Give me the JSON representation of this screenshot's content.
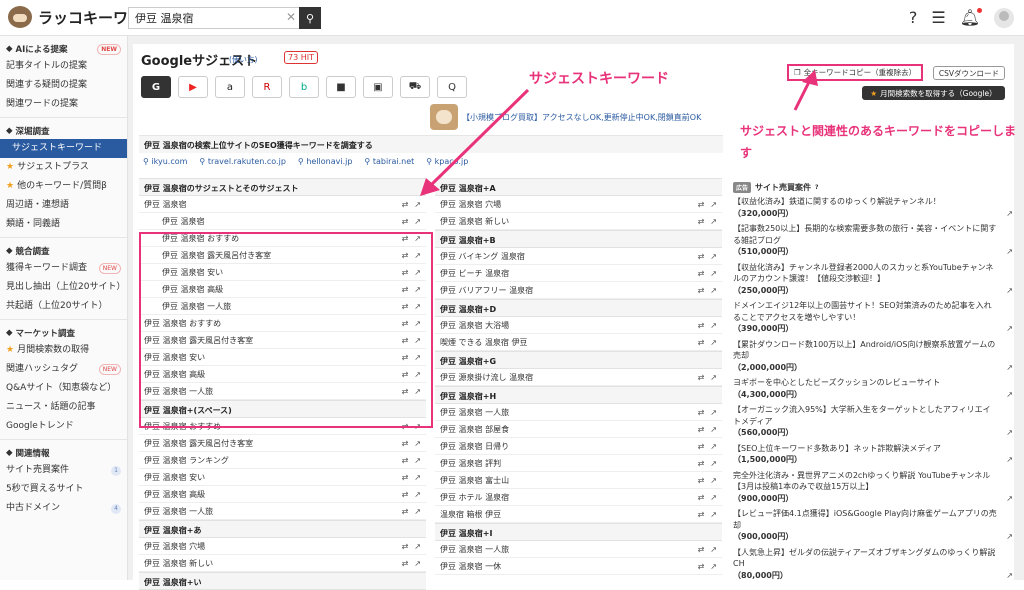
{
  "app": {
    "logo_text": "ラッコキーワード"
  },
  "search": {
    "value": "伊豆 温泉宿"
  },
  "sidebar": {
    "sections": [
      {
        "title": "AIによる提案",
        "badge": "NEW",
        "items": [
          {
            "label": "記事タイトルの提案"
          },
          {
            "label": "関連する疑問の提案"
          },
          {
            "label": "関連ワードの提案"
          }
        ]
      },
      {
        "title": "深堀調査",
        "items": [
          {
            "label": "サジェストキーワード",
            "active": true
          },
          {
            "label": "サジェストプラス",
            "star": true
          },
          {
            "label": "他のキーワード/質問β",
            "star": true
          },
          {
            "label": "周辺語・連想語"
          },
          {
            "label": "類語・同義語"
          }
        ]
      },
      {
        "title": "競合調査",
        "items": [
          {
            "label": "獲得キーワード調査",
            "badge": "NEW"
          },
          {
            "label": "見出し抽出（上位20サイト）"
          },
          {
            "label": "共起語（上位20サイト）"
          }
        ]
      },
      {
        "title": "マーケット調査",
        "items": [
          {
            "label": "月間検索数の取得",
            "star": true
          },
          {
            "label": "関連ハッシュタグ",
            "badge": "NEW"
          },
          {
            "label": "Q&Aサイト（知恵袋など）"
          },
          {
            "label": "ニュース・話題の記事"
          },
          {
            "label": "Googleトレンド"
          }
        ]
      },
      {
        "title": "関連情報",
        "items": [
          {
            "label": "サイト売買案件",
            "count": "1"
          },
          {
            "label": "5秒で買えるサイト"
          },
          {
            "label": "中古ドメイン",
            "count": "4"
          }
        ]
      }
    ]
  },
  "header": {
    "title": "Googleサジェスト",
    "howto": "使い方",
    "hits": "73 HIT",
    "copy_all": "全キーワードコピー（重複除去）",
    "csv": "CSVダウンロード",
    "monthly": "月間検索数を取得する（Google）"
  },
  "engines": [
    {
      "name": "google",
      "label": "G"
    },
    {
      "name": "youtube",
      "label": "▶"
    },
    {
      "name": "amazon",
      "label": "a"
    },
    {
      "name": "rakuten",
      "label": "R"
    },
    {
      "name": "bing",
      "label": "b"
    },
    {
      "name": "video",
      "label": "■"
    },
    {
      "name": "image",
      "label": "▣"
    },
    {
      "name": "shopping",
      "label": "⛟"
    },
    {
      "name": "qa",
      "label": "Q"
    }
  ],
  "banner": {
    "text": "【小規模ブログ買取】アクセスなしOK,更新停止中OK,閉鎖直前OK"
  },
  "seo": {
    "heading": "伊豆 温泉宿の検索上位サイトのSEO獲得キーワードを調査する",
    "sites": [
      "ikyu.com",
      "travel.rakuten.co.jp",
      "hellonavi.jp",
      "tabirai.net",
      "kpaco.jp"
    ]
  },
  "col1": [
    {
      "heading": "伊豆 温泉宿のサジェストとそのサジェスト",
      "rows": [
        {
          "text": "伊豆 温泉宿"
        },
        {
          "text": "伊豆 温泉宿",
          "sub": true
        },
        {
          "text": "伊豆 温泉宿 おすすめ",
          "sub": true
        },
        {
          "text": "伊豆 温泉宿 露天風呂付き客室",
          "sub": true
        },
        {
          "text": "伊豆 温泉宿 安い",
          "sub": true
        },
        {
          "text": "伊豆 温泉宿 高級",
          "sub": true
        },
        {
          "text": "伊豆 温泉宿 一人旅",
          "sub": true
        },
        {
          "text": "伊豆 温泉宿 おすすめ"
        },
        {
          "text": "伊豆 温泉宿 露天風呂付き客室"
        },
        {
          "text": "伊豆 温泉宿 安い"
        },
        {
          "text": "伊豆 温泉宿 高級"
        },
        {
          "text": "伊豆 温泉宿 一人旅"
        }
      ]
    },
    {
      "heading": "伊豆 温泉宿+(スペース)",
      "rows": [
        {
          "text": "伊豆 温泉宿 おすすめ"
        },
        {
          "text": "伊豆 温泉宿 露天風呂付き客室"
        },
        {
          "text": "伊豆 温泉宿 ランキング"
        },
        {
          "text": "伊豆 温泉宿 安い"
        },
        {
          "text": "伊豆 温泉宿 高級"
        },
        {
          "text": "伊豆 温泉宿 一人旅"
        }
      ]
    },
    {
      "heading": "伊豆 温泉宿+あ",
      "rows": [
        {
          "text": "伊豆 温泉宿 穴場"
        },
        {
          "text": "伊豆 温泉宿 新しい"
        }
      ]
    },
    {
      "heading": "伊豆 温泉宿+い",
      "rows": []
    }
  ],
  "col2": [
    {
      "heading": "伊豆 温泉宿+A",
      "rows": [
        {
          "text": "伊豆 温泉宿 穴場"
        },
        {
          "text": "伊豆 温泉宿 新しい"
        }
      ]
    },
    {
      "heading": "伊豆 温泉宿+B",
      "rows": [
        {
          "text": "伊豆 バイキング 温泉宿"
        },
        {
          "text": "伊豆 ビーチ 温泉宿"
        },
        {
          "text": "伊豆 バリアフリー 温泉宿"
        }
      ]
    },
    {
      "heading": "伊豆 温泉宿+D",
      "rows": [
        {
          "text": "伊豆 温泉宿 大浴場"
        },
        {
          "text": "喫煙 できる 温泉宿 伊豆"
        }
      ]
    },
    {
      "heading": "伊豆 温泉宿+G",
      "rows": [
        {
          "text": "伊豆 源泉掛け流し 温泉宿"
        }
      ]
    },
    {
      "heading": "伊豆 温泉宿+H",
      "rows": [
        {
          "text": "伊豆 温泉宿 一人旅"
        },
        {
          "text": "伊豆 温泉宿 部屋食"
        },
        {
          "text": "伊豆 温泉宿 日帰り"
        },
        {
          "text": "伊豆 温泉宿 評判"
        },
        {
          "text": "伊豆 温泉宿 富士山"
        },
        {
          "text": "伊豆 ホテル 温泉宿"
        },
        {
          "text": "温泉宿 箱根 伊豆"
        }
      ]
    },
    {
      "heading": "伊豆 温泉宿+I",
      "rows": [
        {
          "text": "伊豆 温泉宿 一人旅"
        },
        {
          "text": "伊豆 温泉宿 一休"
        }
      ]
    }
  ],
  "ads": {
    "tag": "広告",
    "heading": "サイト売買案件",
    "items": [
      {
        "text": "【収益化済み】鉄道に関するのゆっくり解説チャンネル！",
        "price": "（320,000円）"
      },
      {
        "text": "【記事数250以上】長期的な検索需要多数の旅行・美容・イベントに関する雑記ブログ",
        "price": "（510,000円）"
      },
      {
        "text": "【収益化済み】チャンネル登録者2000人のスカッと系YouTubeチャンネルのアカウント譲渡！【値段交渉歓迎！】",
        "price": "（250,000円）"
      },
      {
        "text": "ドメインエイジ12年以上の園芸サイト！SEO対策済みのため記事を入れることでアクセスを増やしやすい！",
        "price": "（390,000円）"
      },
      {
        "text": "【累計ダウンロード数100万以上】Android/iOS向け観察系放置ゲームの売却",
        "price": "（2,000,000円）"
      },
      {
        "text": "ヨギボーを中心としたビーズクッションのレビューサイト",
        "price": "（4,300,000円）"
      },
      {
        "text": "【オーガニック流入95%】大学新入生をターゲットとしたアフィリエイトメディア",
        "price": "（560,000円）"
      },
      {
        "text": "【SEO上位キーワード多数あり】ネット詐欺解決メディア",
        "price": "（1,500,000円）"
      },
      {
        "text": "完全外注化済み・異世界アニメの2chゆっくり解説 YouTubeチャンネル【3月は投稿1本のみで収益15万以上】",
        "price": "（900,000円）"
      },
      {
        "text": "【レビュー評価4.1点獲得】iOS&Google Play向け麻雀ゲームアプリの売却",
        "price": "（900,000円）"
      },
      {
        "text": "【人気急上昇】ゼルダの伝説ティアーズオブザキングダムのゆっくり解説CH",
        "price": "（80,000円）"
      }
    ]
  },
  "annotations": {
    "suggest": "サジェストキーワード",
    "copy": "サジェストと関連性のあるキーワードをコピーします"
  },
  "colors": {
    "accent": "#e8337a",
    "nav_active": "#2a5aa0"
  }
}
